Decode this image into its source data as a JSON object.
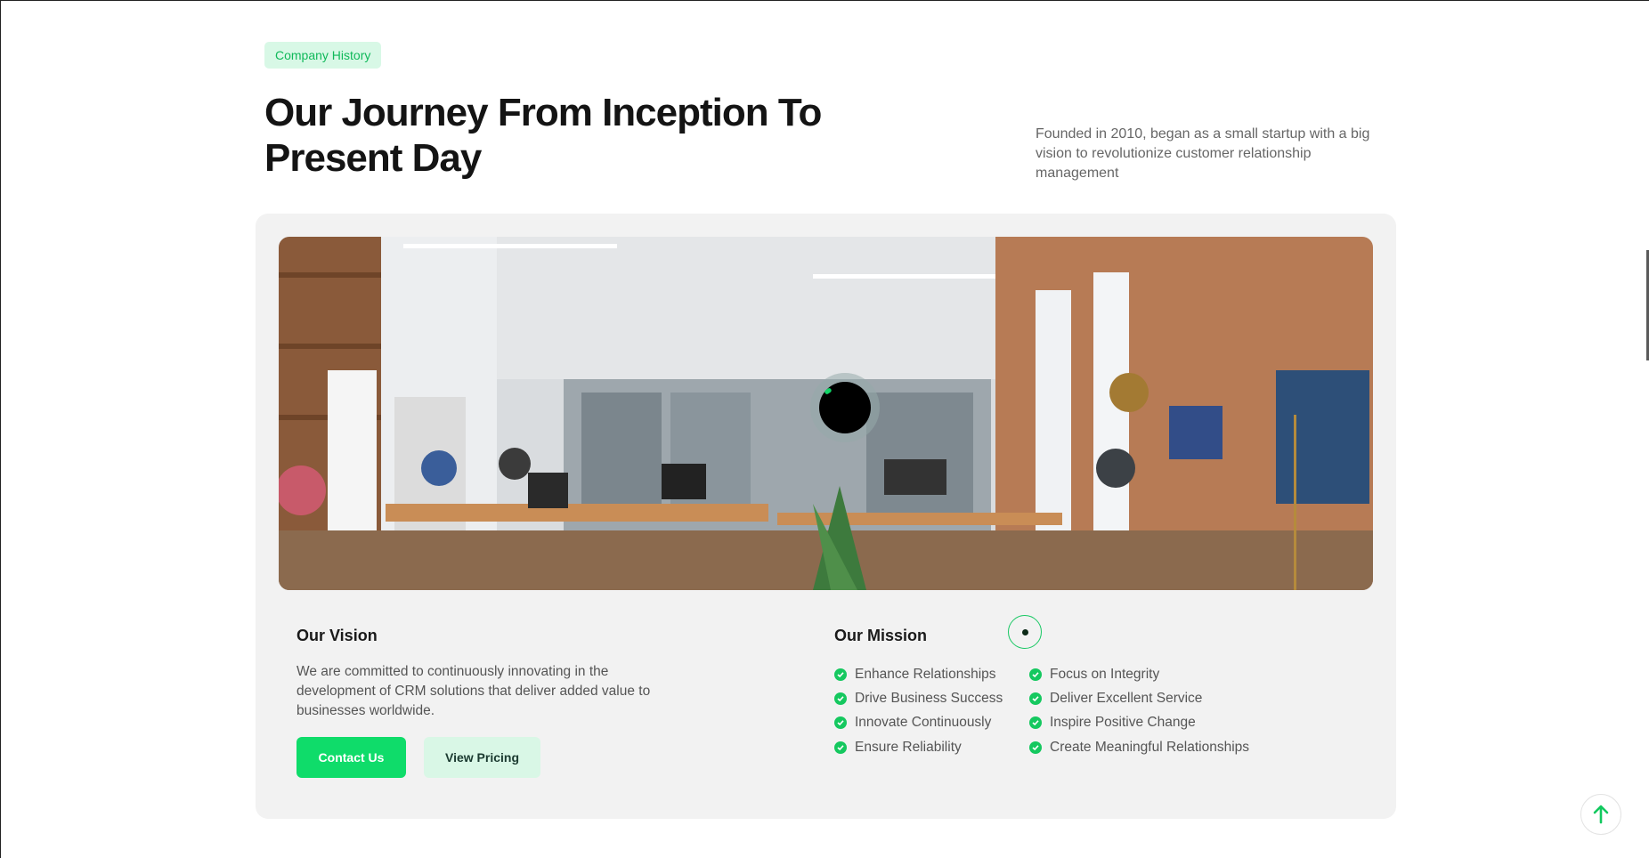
{
  "header": {
    "badge": "Company History",
    "title": "Our Journey From Inception To Present Day",
    "intro": "Founded in 2010, began as a small startup with a big vision to revolutionize customer relationship management"
  },
  "vision": {
    "title": "Our Vision",
    "text": "We are committed to continuously innovating in the development of CRM solutions that deliver added value to businesses worldwide.",
    "contact_label": "Contact Us",
    "pricing_label": "View Pricing"
  },
  "mission": {
    "title": "Our Mission",
    "items_col1": [
      "Enhance Relationships",
      "Drive Business Success",
      "Innovate Continuously",
      "Ensure Reliability"
    ],
    "items_col2": [
      "Focus on Integrity",
      "Deliver Excellent Service",
      "Inspire Positive Change",
      "Create Meaningful Relationships"
    ]
  },
  "media": {
    "icon": "play-icon"
  },
  "colors": {
    "accent": "#0fdc6a",
    "accent_light": "#d8f8e6",
    "card_bg": "#f2f2f2"
  }
}
